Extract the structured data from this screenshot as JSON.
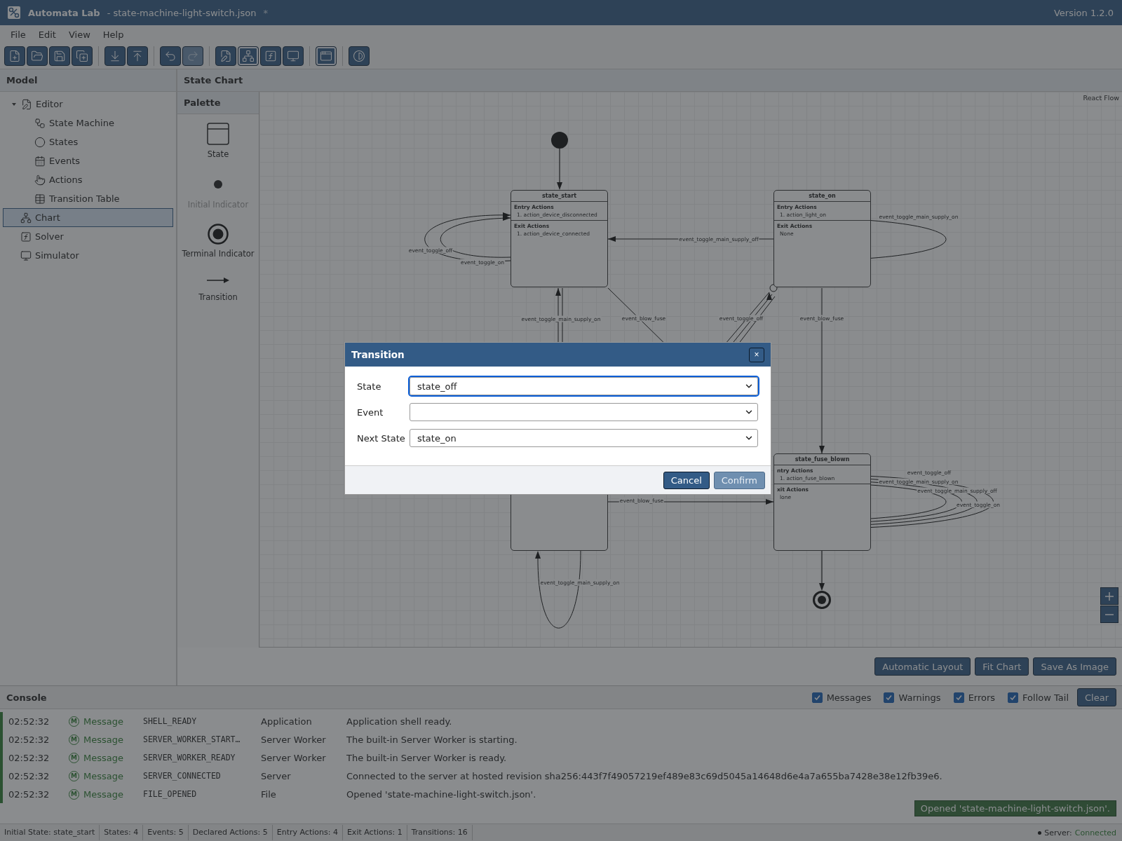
{
  "app": {
    "title": "Automata Lab",
    "file": "- state-machine-light-switch.json",
    "dirty_mark": "*",
    "version": "Version 1.2.0"
  },
  "menu": [
    "File",
    "Edit",
    "View",
    "Help"
  ],
  "toolbar": [
    [
      {
        "kind": "new",
        "active": false,
        "disabled": false
      },
      {
        "kind": "open",
        "active": false,
        "disabled": false
      },
      {
        "kind": "save",
        "active": false,
        "disabled": false
      },
      {
        "kind": "duplicate",
        "active": false,
        "disabled": false
      }
    ],
    [
      {
        "kind": "import",
        "active": false,
        "disabled": false
      },
      {
        "kind": "export",
        "active": false,
        "disabled": false
      }
    ],
    [
      {
        "kind": "undo",
        "active": false,
        "disabled": false
      },
      {
        "kind": "redo",
        "active": false,
        "disabled": true
      }
    ],
    [
      {
        "kind": "editor",
        "active": false,
        "disabled": false
      },
      {
        "kind": "chart",
        "active": true,
        "disabled": false
      },
      {
        "kind": "solver",
        "active": false,
        "disabled": false
      },
      {
        "kind": "simulator",
        "active": false,
        "disabled": false
      }
    ],
    [
      {
        "kind": "panel",
        "active": true,
        "disabled": false
      }
    ],
    [
      {
        "kind": "theme",
        "active": false,
        "disabled": false
      }
    ]
  ],
  "sidebar": {
    "title": "Model",
    "items": [
      {
        "label": "Editor",
        "kind": "editor",
        "expanded": true,
        "selected": false,
        "children": [
          {
            "label": "State Machine",
            "kind": "machine",
            "selected": false
          },
          {
            "label": "States",
            "kind": "states",
            "selected": false
          },
          {
            "label": "Events",
            "kind": "events",
            "selected": false
          },
          {
            "label": "Actions",
            "kind": "actions",
            "selected": false
          },
          {
            "label": "Transition Table",
            "kind": "table",
            "selected": false
          }
        ]
      },
      {
        "label": "Chart",
        "kind": "chart",
        "selected": true
      },
      {
        "label": "Solver",
        "kind": "solver",
        "selected": false
      },
      {
        "label": "Simulator",
        "kind": "simulator",
        "selected": false
      }
    ]
  },
  "chart_panel": {
    "title": "State Chart",
    "palette": {
      "title": "Palette",
      "items": [
        {
          "label": "State",
          "kind": "state",
          "disabled": false
        },
        {
          "label": "Initial Indicator",
          "kind": "initial",
          "disabled": true
        },
        {
          "label": "Terminal Indicator",
          "kind": "terminal",
          "disabled": false
        },
        {
          "label": "Transition",
          "kind": "transition",
          "disabled": false
        }
      ]
    },
    "attribution": "React Flow",
    "nodes": [
      {
        "kind": "initial"
      },
      {
        "kind": "state",
        "title": "state_start",
        "sections": [
          {
            "heading": "Entry Actions",
            "lines": [
              "1. action_device_disconnected"
            ]
          },
          {
            "heading": "Exit Actions",
            "lines": [
              "1. action_device_connected"
            ]
          }
        ]
      },
      {
        "kind": "state",
        "title": "state_on",
        "sections": [
          {
            "heading": "Entry Actions",
            "lines": [
              "1. action_light_on"
            ]
          },
          {
            "heading": "Exit Actions",
            "lines": [
              "None"
            ]
          }
        ]
      },
      {
        "kind": "state"
      },
      {
        "kind": "state",
        "title": "state_fuse_blown",
        "sections": [
          {
            "heading": "ntry Actions",
            "lines": [
              "1. action_fuse_blown"
            ]
          },
          {
            "heading": "xit Actions",
            "lines": [
              "lone"
            ]
          }
        ]
      },
      {
        "kind": "terminal"
      }
    ],
    "edges": [
      {
        "label": "event_toggle_off"
      },
      {
        "label": "event_toggle_on"
      },
      {
        "label": "event_toggle_main_supply_off"
      },
      {
        "label": "event_toggle_main_supply_on"
      },
      {
        "label": "event_toggle_main_supply_on"
      },
      {
        "label": "event_blow_fuse"
      },
      {
        "label": "event_toggle_off"
      },
      {
        "label": "event_blow_fuse"
      },
      {
        "label": "event_blow_fuse"
      },
      {
        "label": "event_toggle_off"
      },
      {
        "label": "event_toggle_main_supply_on"
      },
      {
        "label": "event_toggle_main_supply_off"
      },
      {
        "label": "event_toggle_on"
      },
      {
        "label": "event_toggle_main_supply_on"
      }
    ],
    "actions": [
      "Automatic Layout",
      "Fit Chart",
      "Save As Image"
    ]
  },
  "dialog": {
    "title": "Transition",
    "close": "×",
    "fields": [
      {
        "label": "State",
        "value": "state_off",
        "focused": true
      },
      {
        "label": "Event",
        "focused": false
      },
      {
        "label": "Next State",
        "value": "state_on",
        "focused": false
      }
    ],
    "buttons": [
      {
        "label": "Cancel",
        "disabled": false
      },
      {
        "label": "Confirm",
        "disabled": true
      }
    ]
  },
  "console": {
    "title": "Console",
    "filters": [
      {
        "label": "Messages",
        "checked": true
      },
      {
        "label": "Warnings",
        "checked": true
      },
      {
        "label": "Errors",
        "checked": true
      },
      {
        "label": "Follow Tail",
        "checked": true
      }
    ],
    "clear": "Clear",
    "rows": [
      {
        "time": "02:52:32",
        "badge": "M",
        "level": "Message",
        "kind": "message",
        "code": "SHELL_READY",
        "source": "Application",
        "text": "Application shell ready."
      },
      {
        "time": "02:52:32",
        "badge": "M",
        "level": "Message",
        "kind": "message",
        "code": "SERVER_WORKER_START…",
        "source": "Server Worker",
        "text": "The built-in Server Worker is starting."
      },
      {
        "time": "02:52:32",
        "badge": "M",
        "level": "Message",
        "kind": "message",
        "code": "SERVER_WORKER_READY",
        "source": "Server Worker",
        "text": "The built-in Server Worker is ready."
      },
      {
        "time": "02:52:32",
        "badge": "M",
        "level": "Message",
        "kind": "message",
        "code": "SERVER_CONNECTED",
        "source": "Server",
        "text": "Connected to the server at hosted revision sha256:443f7f49057219ef489e83c69d5045a14648d6e4a7a655ba7428e38e12fb39e6."
      },
      {
        "time": "02:52:32",
        "badge": "M",
        "level": "Message",
        "kind": "message",
        "code": "FILE_OPENED",
        "source": "File",
        "text": "Opened 'state-machine-light-switch.json'."
      }
    ],
    "toast": "Opened 'state-machine-light-switch.json'."
  },
  "status_bar": {
    "items": [
      "Initial State: state_start",
      "States: 4",
      "Events: 5",
      "Declared Actions: 5",
      "Entry Actions: 4",
      "Exit Actions: 1",
      "Transitions: 16"
    ],
    "server": {
      "label": "Server:",
      "value": "Connected"
    }
  }
}
